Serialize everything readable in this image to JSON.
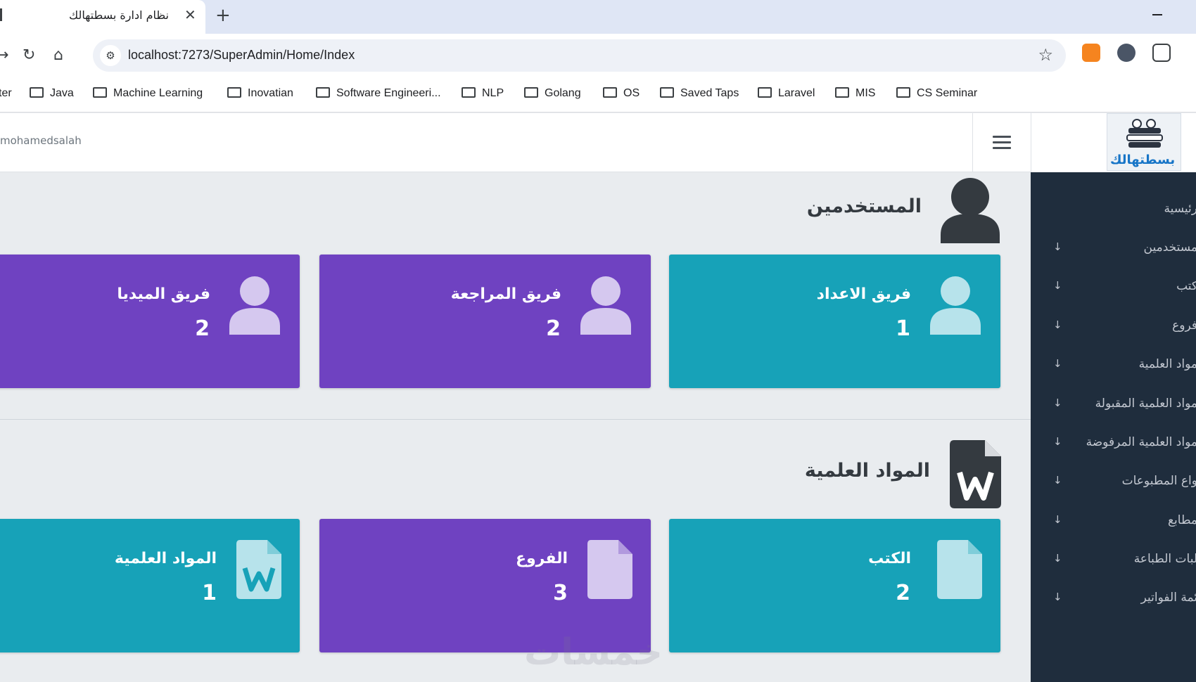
{
  "browser": {
    "tab_title": "نظام ادارة بسطتهالك",
    "tab_close": "✕",
    "new_tab": "+",
    "url": "localhost:7273/SuperAdmin/Home/Index",
    "bookmarks": [
      "ter",
      "Java",
      "Machine Learning",
      "Inovatian",
      "Software Engineeri...",
      "NLP",
      "Golang",
      "OS",
      "Saved Taps",
      "Laravel",
      "MIS",
      "CS Seminar"
    ]
  },
  "header": {
    "username": "mohamedsalah"
  },
  "brand": {
    "logo_text": "بسطتهالك"
  },
  "sidebar": {
    "items": [
      {
        "label": "رئيسية",
        "arrow": ""
      },
      {
        "label": "مستخدمين",
        "arrow": "↓"
      },
      {
        "label": "كتب",
        "arrow": "↓"
      },
      {
        "label": "فروع",
        "arrow": "↓"
      },
      {
        "label": "مواد العلمية",
        "arrow": "↓"
      },
      {
        "label": "مواد العلمية المقبولة",
        "arrow": "↓"
      },
      {
        "label": "مواد العلمية المرفوضة",
        "arrow": "↓"
      },
      {
        "label": "واع المطبوعات",
        "arrow": "↓"
      },
      {
        "label": "مطابع",
        "arrow": "↓"
      },
      {
        "label": "لبات الطباعة",
        "arrow": "↓"
      },
      {
        "label": "ئمة الفواتير",
        "arrow": "↓"
      }
    ]
  },
  "sections": {
    "users": {
      "title": "المستخدمين",
      "cards": [
        {
          "label": "فريق الاعداد",
          "count": "1",
          "color": "#17a2b8"
        },
        {
          "label": "فريق المراجعة",
          "count": "2",
          "color": "#6f42c1"
        },
        {
          "label": "فريق الميديا",
          "count": "2",
          "color": "#6f42c1"
        }
      ]
    },
    "materials": {
      "title": "المواد العلمية",
      "cards": [
        {
          "label": "الكتب",
          "count": "2",
          "color": "#17a2b8"
        },
        {
          "label": "الفروع",
          "count": "3",
          "color": "#6f42c1"
        },
        {
          "label": "المواد العلمية",
          "count": "1",
          "color": "#17a2b8"
        }
      ]
    }
  },
  "watermark": "خمسات"
}
